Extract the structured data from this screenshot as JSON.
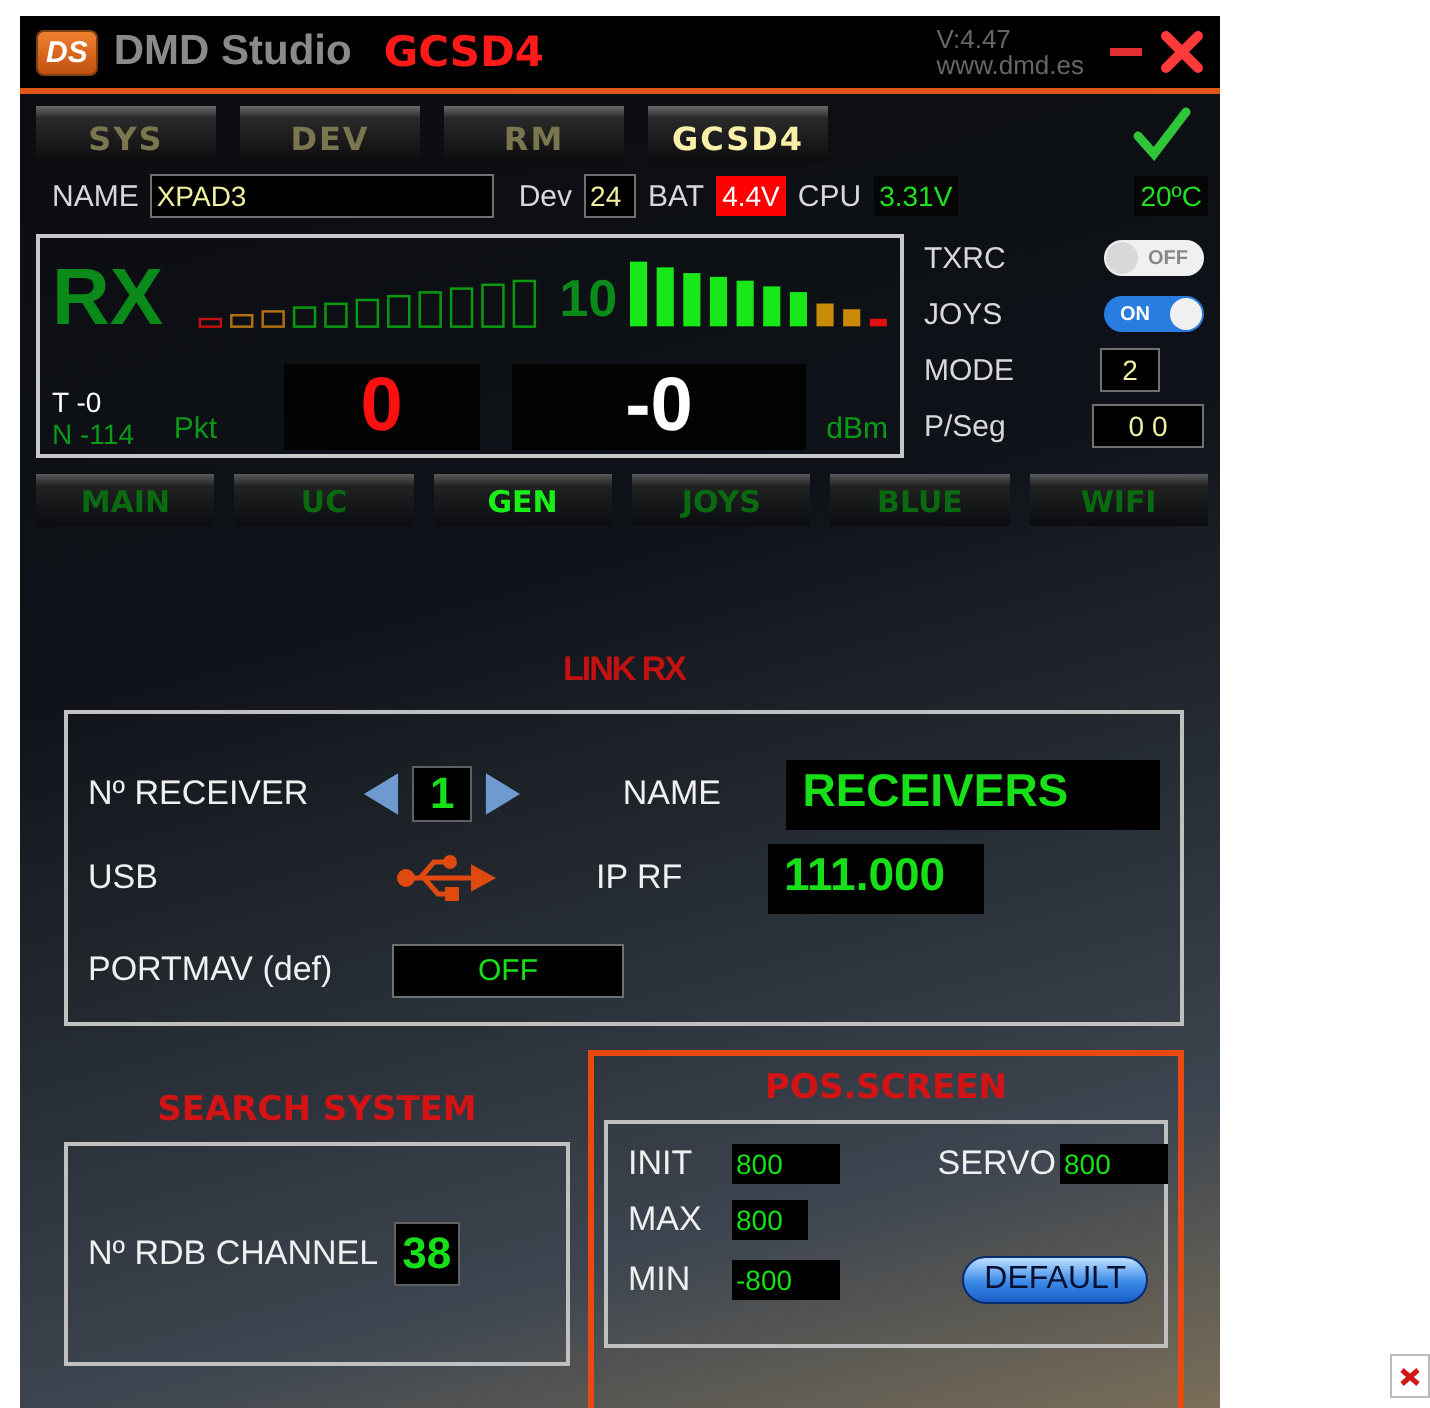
{
  "window": {
    "logo": "DS",
    "title": "DMD Studio",
    "model": "GCSD4",
    "version": "V:4.47",
    "website": "www.dmd.es"
  },
  "tabs": [
    {
      "label": "SYS",
      "selected": false
    },
    {
      "label": "DEV",
      "selected": false
    },
    {
      "label": "RM",
      "selected": false
    },
    {
      "label": "GCSD4",
      "selected": true
    }
  ],
  "device": {
    "name_label": "NAME",
    "name": "XPAD3",
    "dev_label": "Dev",
    "dev": "24",
    "bat_label": "BAT",
    "bat": "4.4V",
    "cpu_label": "CPU",
    "cpu": "3.31V",
    "temperature": "20ºC"
  },
  "rx": {
    "title": "RX",
    "signal": "10",
    "t": "T -0",
    "n": "N -114",
    "pkt_label": "Pkt",
    "pkt": "0",
    "dbm": "-0",
    "dbm_label": "dBm"
  },
  "switches": [
    {
      "label": "TXRC",
      "on": false,
      "text": "OFF"
    },
    {
      "label": "JOYS",
      "on": true,
      "text": "ON"
    }
  ],
  "mode": {
    "label": "MODE",
    "value": "2"
  },
  "pseg": {
    "label": "P/Seg",
    "value": "0 0"
  },
  "subtabs": [
    {
      "label": "MAIN",
      "selected": false
    },
    {
      "label": "UC",
      "selected": false
    },
    {
      "label": "GEN",
      "selected": true
    },
    {
      "label": "JOYS",
      "selected": false
    },
    {
      "label": "BLUE",
      "selected": false
    },
    {
      "label": "WIFI",
      "selected": false
    }
  ],
  "link_rx": {
    "title": "LINK RX",
    "receiver_label": "Nº RECEIVER",
    "receiver": "1",
    "name_label": "NAME",
    "name": "RECEIVERS",
    "usb_label": "USB",
    "ip_label": "IP RF",
    "ip": "111.000",
    "portmav_label": "PORTMAV (def)",
    "portmav": "OFF"
  },
  "search_system": {
    "title": "SEARCH SYSTEM",
    "channel_label": "Nº RDB CHANNEL",
    "channel": "38"
  },
  "pos_screen": {
    "title": "POS.SCREEN",
    "init_label": "INIT",
    "init": "800",
    "max_label": "MAX",
    "max": "800",
    "min_label": "MIN",
    "min": "-800",
    "servo_label": "SERVO",
    "servo": "800",
    "button": "DEFAULT"
  }
}
